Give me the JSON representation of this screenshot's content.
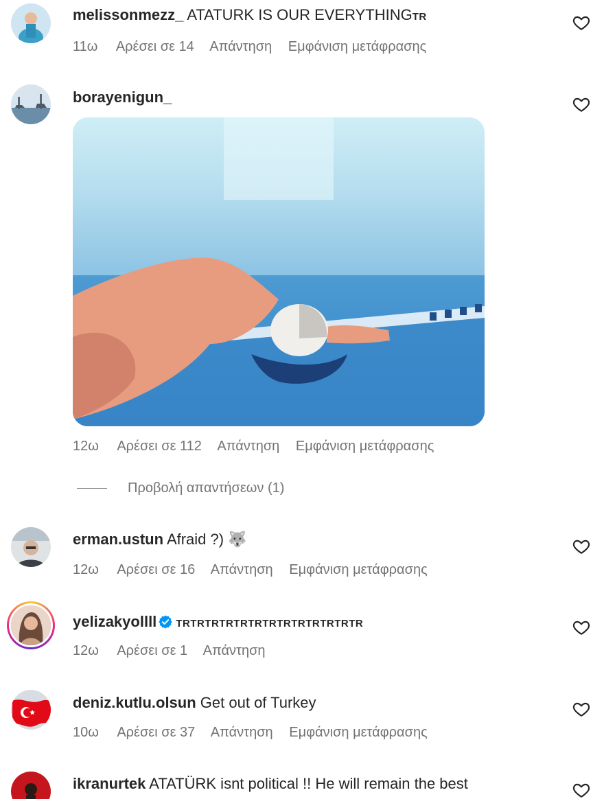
{
  "comments": [
    {
      "username": "melissonmezz_",
      "text": "ATATURK IS OUR EVERYTHING",
      "flag_text": "TR",
      "time": "11ω",
      "likes": "Αρέσει σε 14",
      "reply": "Απάντηση",
      "translate": "Εμφάνιση μετάφρασης"
    },
    {
      "username": "borayenigun_",
      "text": "",
      "time": "12ω",
      "likes": "Αρέσει σε 112",
      "reply": "Απάντηση",
      "translate": "Εμφάνιση μετάφρασης",
      "view_replies": "Προβολή απαντήσεων (1)"
    },
    {
      "username": "erman.ustun",
      "text": "Afraid ?)",
      "emoji": "🐺",
      "time": "12ω",
      "likes": "Αρέσει σε 16",
      "reply": "Απάντηση",
      "translate": "Εμφάνιση μετάφρασης"
    },
    {
      "username": "yelizakyollll",
      "verified": true,
      "text": "TRTRTRTRTRTRTRTRTRTRTRTRTR",
      "time": "12ω",
      "likes": "Αρέσει σε 1",
      "reply": "Απάντηση"
    },
    {
      "username": "deniz.kutlu.olsun",
      "text": "Get out of Turkey",
      "time": "10ω",
      "likes": "Αρέσει σε 37",
      "reply": "Απάντηση",
      "translate": "Εμφάνιση μετάφρασης"
    },
    {
      "username": "ikranurtek",
      "text": "ATATÜRK isnt political !! He will remain the best"
    }
  ],
  "icons": {
    "like": "heart-outline-icon",
    "verified": "verified-badge-icon"
  },
  "colors": {
    "text": "#262626",
    "meta": "#737373",
    "verified": "#0095f6"
  }
}
